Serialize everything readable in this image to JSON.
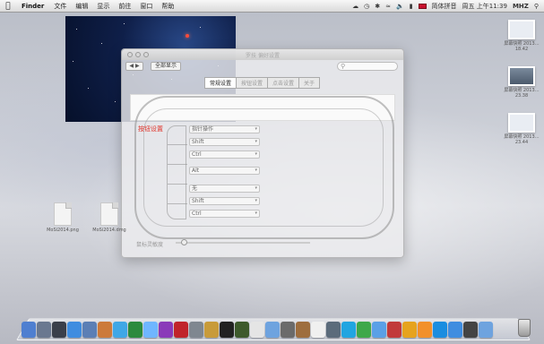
{
  "menubar": {
    "apple_icon": "apple-icon",
    "app_name": "Finder",
    "items": [
      "文件",
      "编辑",
      "显示",
      "前往",
      "窗口",
      "帮助"
    ],
    "clock": "周五 上午11:39",
    "user": "MHZ",
    "input_method": "简体拼音"
  },
  "window": {
    "title": "罗技 偏好设置",
    "show_all": "全部显示",
    "tabs": [
      "常规设置",
      "按钮设置",
      "点击设置",
      "关于"
    ],
    "active_tab": 0,
    "red_label": "按钮设置",
    "dropdowns": [
      "指针操作",
      "Shift",
      "Ctrl",
      "Alt",
      "无",
      "Shift",
      "Ctrl"
    ],
    "slider_label": "鼠标灵敏度"
  },
  "desktop": {
    "left_icons": [
      {
        "name": "desk-file-1",
        "caption": "MoSi2014.png"
      },
      {
        "name": "desk-file-2",
        "caption": "MoSi2014.dmg"
      }
    ],
    "right_icons": [
      {
        "caption": "屏幕快照 2013…18.42"
      },
      {
        "caption": "屏幕快照 2013…23.38"
      },
      {
        "caption": "屏幕快照 2013…23.44"
      }
    ]
  },
  "dock": {
    "icons": [
      "finder-icon",
      "rocket-icon",
      "mission-control-icon",
      "safari-icon",
      "mail-icon",
      "contacts-icon",
      "ichat-icon",
      "facetime-icon",
      "preview-icon",
      "itunes-icon",
      "photo-booth-icon",
      "system-prefs-icon",
      "dictionary-icon",
      "terminal-icon",
      "activity-icon",
      "calendar-icon",
      "folder-icon",
      "applescript-icon",
      "font-book-icon",
      "textedit-icon",
      "capture-icon",
      "qq-icon",
      "photo-icon",
      "download-folder-icon",
      "parallels-icon",
      "app-icon",
      "vlc-icon",
      "network-icon",
      "safari2-icon",
      "dashboard-icon",
      "downloads-stack-icon"
    ],
    "colors": [
      "#4f7fd0",
      "#6a7890",
      "#3a3f4a",
      "#3f8de0",
      "#5b7fb5",
      "#cc7a3a",
      "#3fa7e6",
      "#2b8a3e",
      "#6fb6ff",
      "#8a3ab9",
      "#c0242b",
      "#7f8790",
      "#c89b3a",
      "#222222",
      "#3d5a2c",
      "#e5e5e5",
      "#6ea3df",
      "#6b6b6b",
      "#9e6e3e",
      "#f0f0f0",
      "#5b6b7b",
      "#21a5e1",
      "#3ea84a",
      "#5aa0e6",
      "#c13a3a",
      "#e6a31e",
      "#f2902a",
      "#1a8de0",
      "#3f8de0",
      "#444444",
      "#6ea3df"
    ]
  },
  "trash_icon": "trash-icon"
}
